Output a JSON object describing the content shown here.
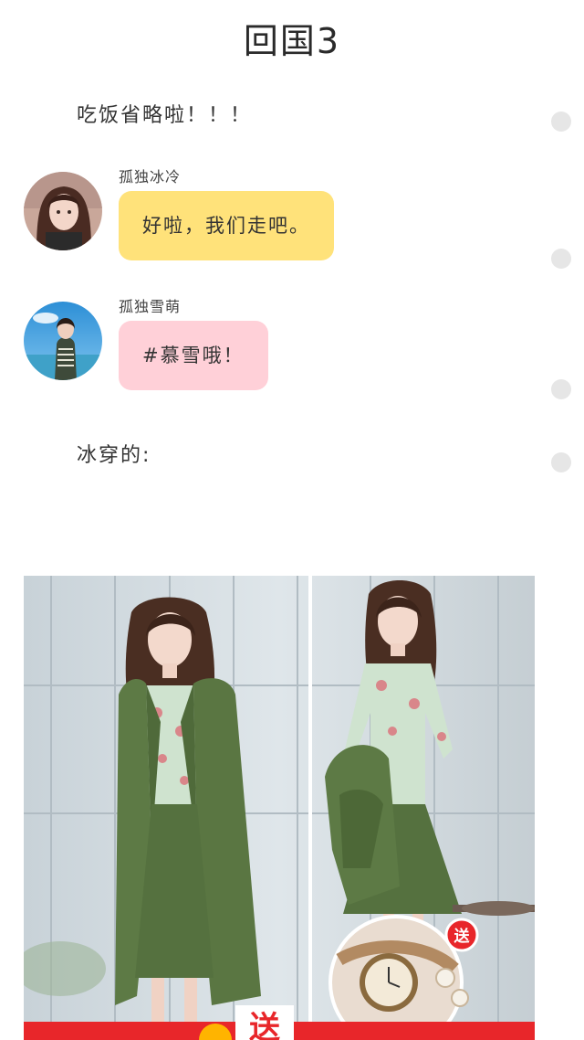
{
  "chapter": {
    "title": "回国3"
  },
  "narration": [
    "吃饭省略啦！！！",
    "冰穿的:"
  ],
  "messages": [
    {
      "sender": "孤独冰冷",
      "text": "好啦，我们走吧。",
      "bubble_color": "#ffe27a"
    },
    {
      "sender": "孤独雪萌",
      "text": "#慕雪哦！",
      "bubble_color": "#ffd0d8"
    }
  ],
  "photo": {
    "badge_label": "送",
    "banner_label": "送"
  },
  "colors": {
    "yellow_bubble": "#ffe27a",
    "pink_bubble": "#ffd0d8",
    "coat_green": "#5d7a45",
    "banner_red": "#e8262a"
  }
}
